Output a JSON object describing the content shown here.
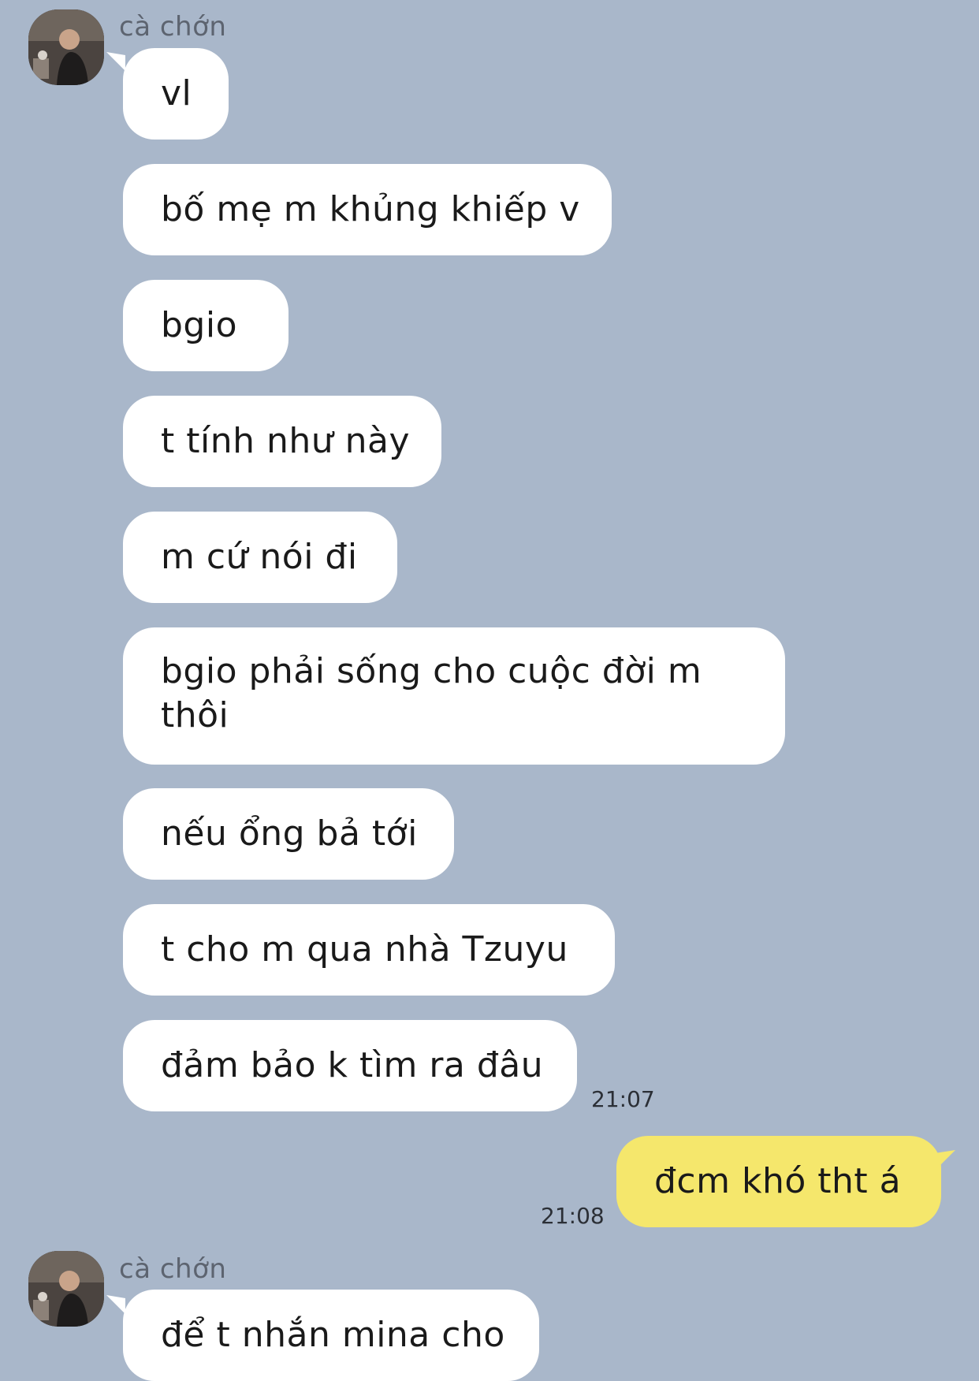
{
  "messages": [
    {
      "sender": "cà chớn",
      "text": "vl"
    },
    {
      "text": "bố mẹ m khủng khiếp v"
    },
    {
      "text": "bgio"
    },
    {
      "text": "t tính như này"
    },
    {
      "text": "m cứ nói đi"
    },
    {
      "text": "bgio phải sống cho cuộc đời m thôi"
    },
    {
      "text": "nếu ổng bả tới"
    },
    {
      "text": "t cho m qua nhà Tzuyu"
    },
    {
      "text": "đảm bảo k tìm ra đâu",
      "time": "21:07"
    },
    {
      "text": "đcm khó tht á",
      "time": "21:08",
      "mine": true
    },
    {
      "sender": "cà chớn",
      "text": "để t nhắn mina cho"
    }
  ],
  "colors": {
    "background": "#a9b7ca",
    "incoming_bubble": "#ffffff",
    "outgoing_bubble": "#f5e76c"
  }
}
